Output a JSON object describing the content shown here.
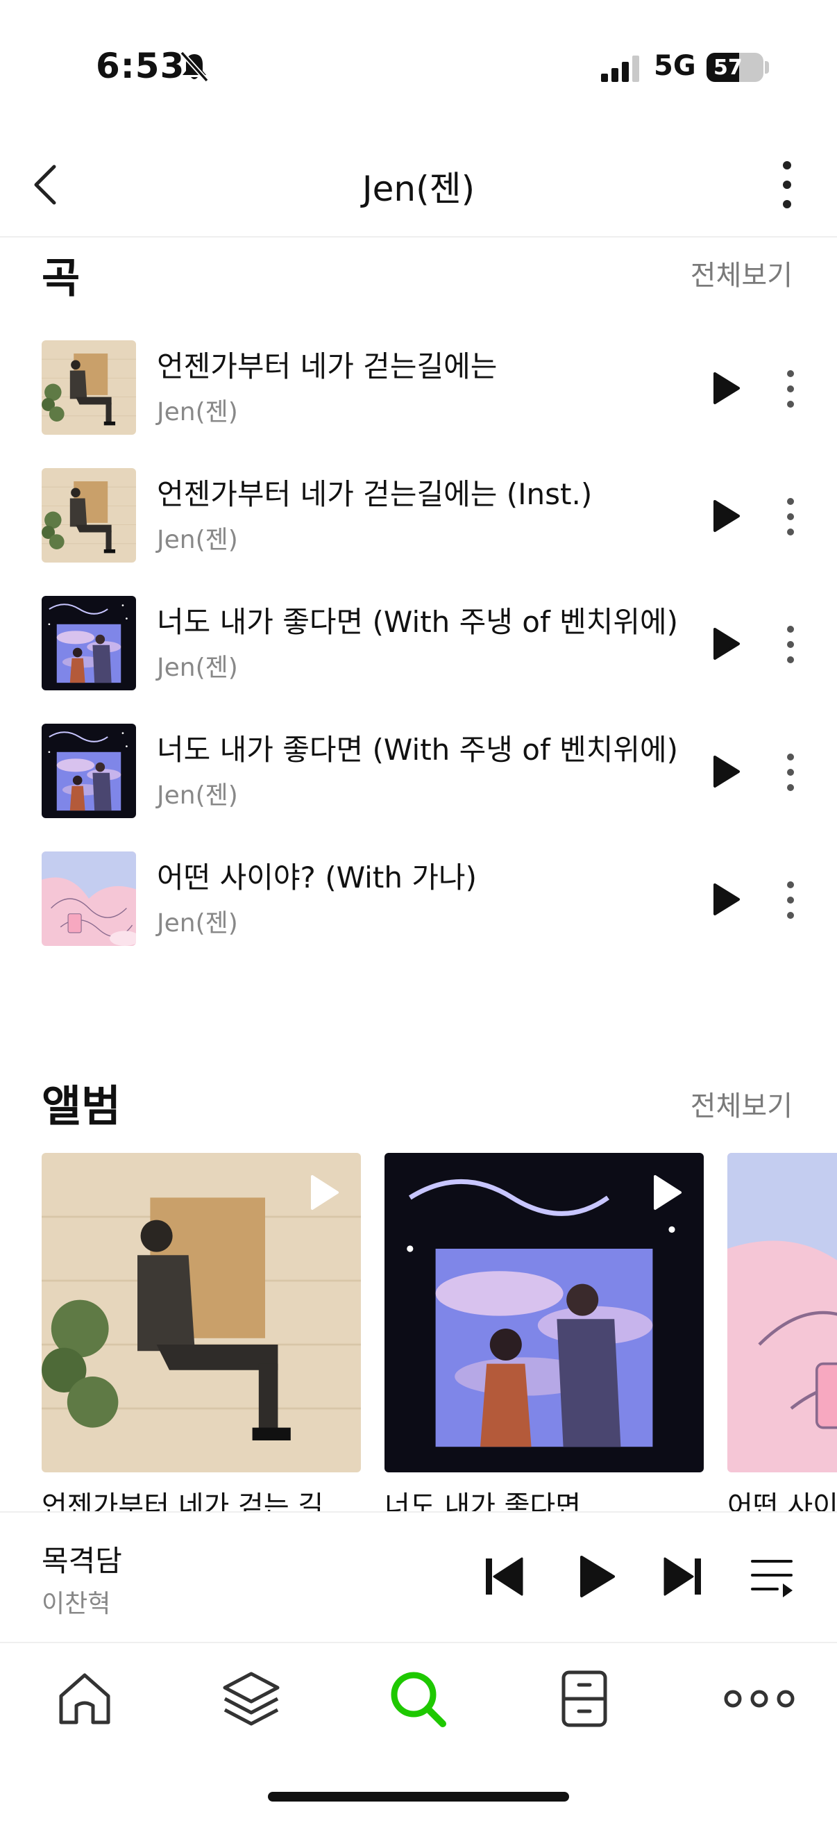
{
  "status_bar": {
    "time": "6:53",
    "network": "5G",
    "battery": "57",
    "battery_level": 0.57
  },
  "header": {
    "title": "Jen(젠)"
  },
  "songs_section": {
    "title": "곡",
    "see_all": "전체보기",
    "items": [
      {
        "title": "언젠가부터 네가 걷는길에는",
        "artist": "Jen(젠)",
        "art": "sit"
      },
      {
        "title": "언젠가부터 네가 걷는길에는 (Inst.)",
        "artist": "Jen(젠)",
        "art": "sit"
      },
      {
        "title": "너도 내가 좋다면 (With 주냉 of 벤치위에)",
        "artist": "Jen(젠)",
        "art": "night"
      },
      {
        "title": "너도 내가 좋다면 (With 주냉 of 벤치위에)",
        "artist": "Jen(젠)",
        "art": "night"
      },
      {
        "title": "어떤 사이야? (With 가나)",
        "artist": "Jen(젠)",
        "art": "pink"
      }
    ]
  },
  "albums_section": {
    "title": "앨범",
    "see_all": "전체보기",
    "items": [
      {
        "title": "언젠가부터 네가 걷는 길",
        "art": "sit"
      },
      {
        "title": "너도 내가 좋다면",
        "art": "night"
      },
      {
        "title": "어떤 사이",
        "art": "pink"
      }
    ]
  },
  "mini_player": {
    "title": "목격담",
    "artist": "이찬혁"
  },
  "tabs": [
    "home",
    "library",
    "search",
    "storage",
    "more"
  ],
  "colors": {
    "accent": "#1ec800",
    "muted": "#888888"
  }
}
